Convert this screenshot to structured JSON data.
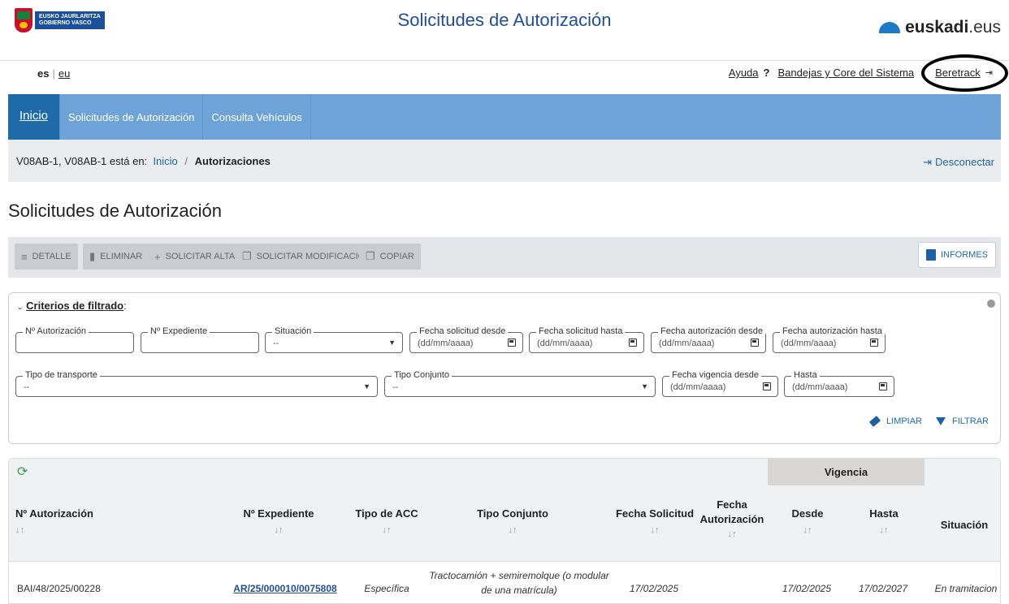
{
  "header": {
    "gov_text": "EUSKO JAURLARITZA\nGOBIERNO VASCO",
    "site_title": "Solicitudes de Autorización",
    "euskadi_brand": "euskadi",
    "euskadi_suffix": ".eus"
  },
  "utility": {
    "lang_active": "es",
    "lang_other": "eu",
    "help_label": "Ayuda",
    "help_icon": "?",
    "trays_label": "Bandejas y Core del Sistema",
    "user_label": "Beretrack",
    "user_icon": "sign-in-icon"
  },
  "nav": {
    "items": [
      "Inicio",
      "Solicitudes de Autorización",
      "Consulta Vehículos"
    ]
  },
  "breadcrumb": {
    "prefix": "V08AB-1, V08AB-1 está en:",
    "home": "Inicio",
    "separator": "/",
    "current": "Autorizaciones",
    "logout": "Desconectar"
  },
  "page_title": "Solicitudes de Autorización",
  "toolbar": {
    "detalle": "DETALLE",
    "eliminar": "ELIMINAR",
    "solicitar_alta": "SOLICITAR ALTA",
    "solicitar_modificacion": "SOLICITAR MODIFICACIÓN",
    "copiar": "COPIAR",
    "informes": "INFORMES"
  },
  "filters": {
    "title": "Criterios de filtrado",
    "colon": ":",
    "n_autorizacion": "Nº Autorización",
    "n_expediente": "Nº Expediente",
    "situacion": "Situación",
    "situacion_value": "--",
    "fecha_sol_desde": "Fecha solicitud desde",
    "fecha_sol_hasta": "Fecha solicitud hasta",
    "fecha_aut_desde": "Fecha autorización desde",
    "fecha_aut_hasta": "Fecha autorización hasta",
    "date_placeholder": "(dd/mm/aaaa)",
    "tipo_transporte": "Tipo de transporte",
    "tipo_transporte_value": "--",
    "tipo_conjunto": "Tipo Conjunto",
    "tipo_conjunto_value": "--",
    "fecha_vig_desde": "Fecha vigencia desde",
    "hasta": "Hasta",
    "limpiar": "LIMPIAR",
    "filtrar": "FILTRAR"
  },
  "table": {
    "group_header": "Vigencia",
    "columns": {
      "n_autorizacion": "Nº Autorización",
      "n_expediente": "Nº Expediente",
      "tipo_acc": "Tipo de ACC",
      "tipo_conjunto": "Tipo Conjunto",
      "fecha_solicitud": "Fecha Solicitud",
      "fecha_autorizacion_1": "Fecha",
      "fecha_autorizacion_2": "Autorización",
      "desde": "Desde",
      "hasta": "Hasta",
      "situacion": "Situación"
    },
    "sort_glyph": "↓↑",
    "rows": [
      {
        "n_autorizacion": "BAI/48/2025/00228",
        "n_expediente": "AR/25/000010/0075808",
        "tipo_acc": "Específica",
        "tipo_conjunto_1": "Tractocamión + semiremolque (o modular",
        "tipo_conjunto_2": "de una matrícula)",
        "fecha_solicitud": "17/02/2025",
        "fecha_autorizacion": "",
        "desde": "17/02/2025",
        "hasta": "17/02/2027",
        "situacion": "En tramitacion"
      }
    ]
  }
}
